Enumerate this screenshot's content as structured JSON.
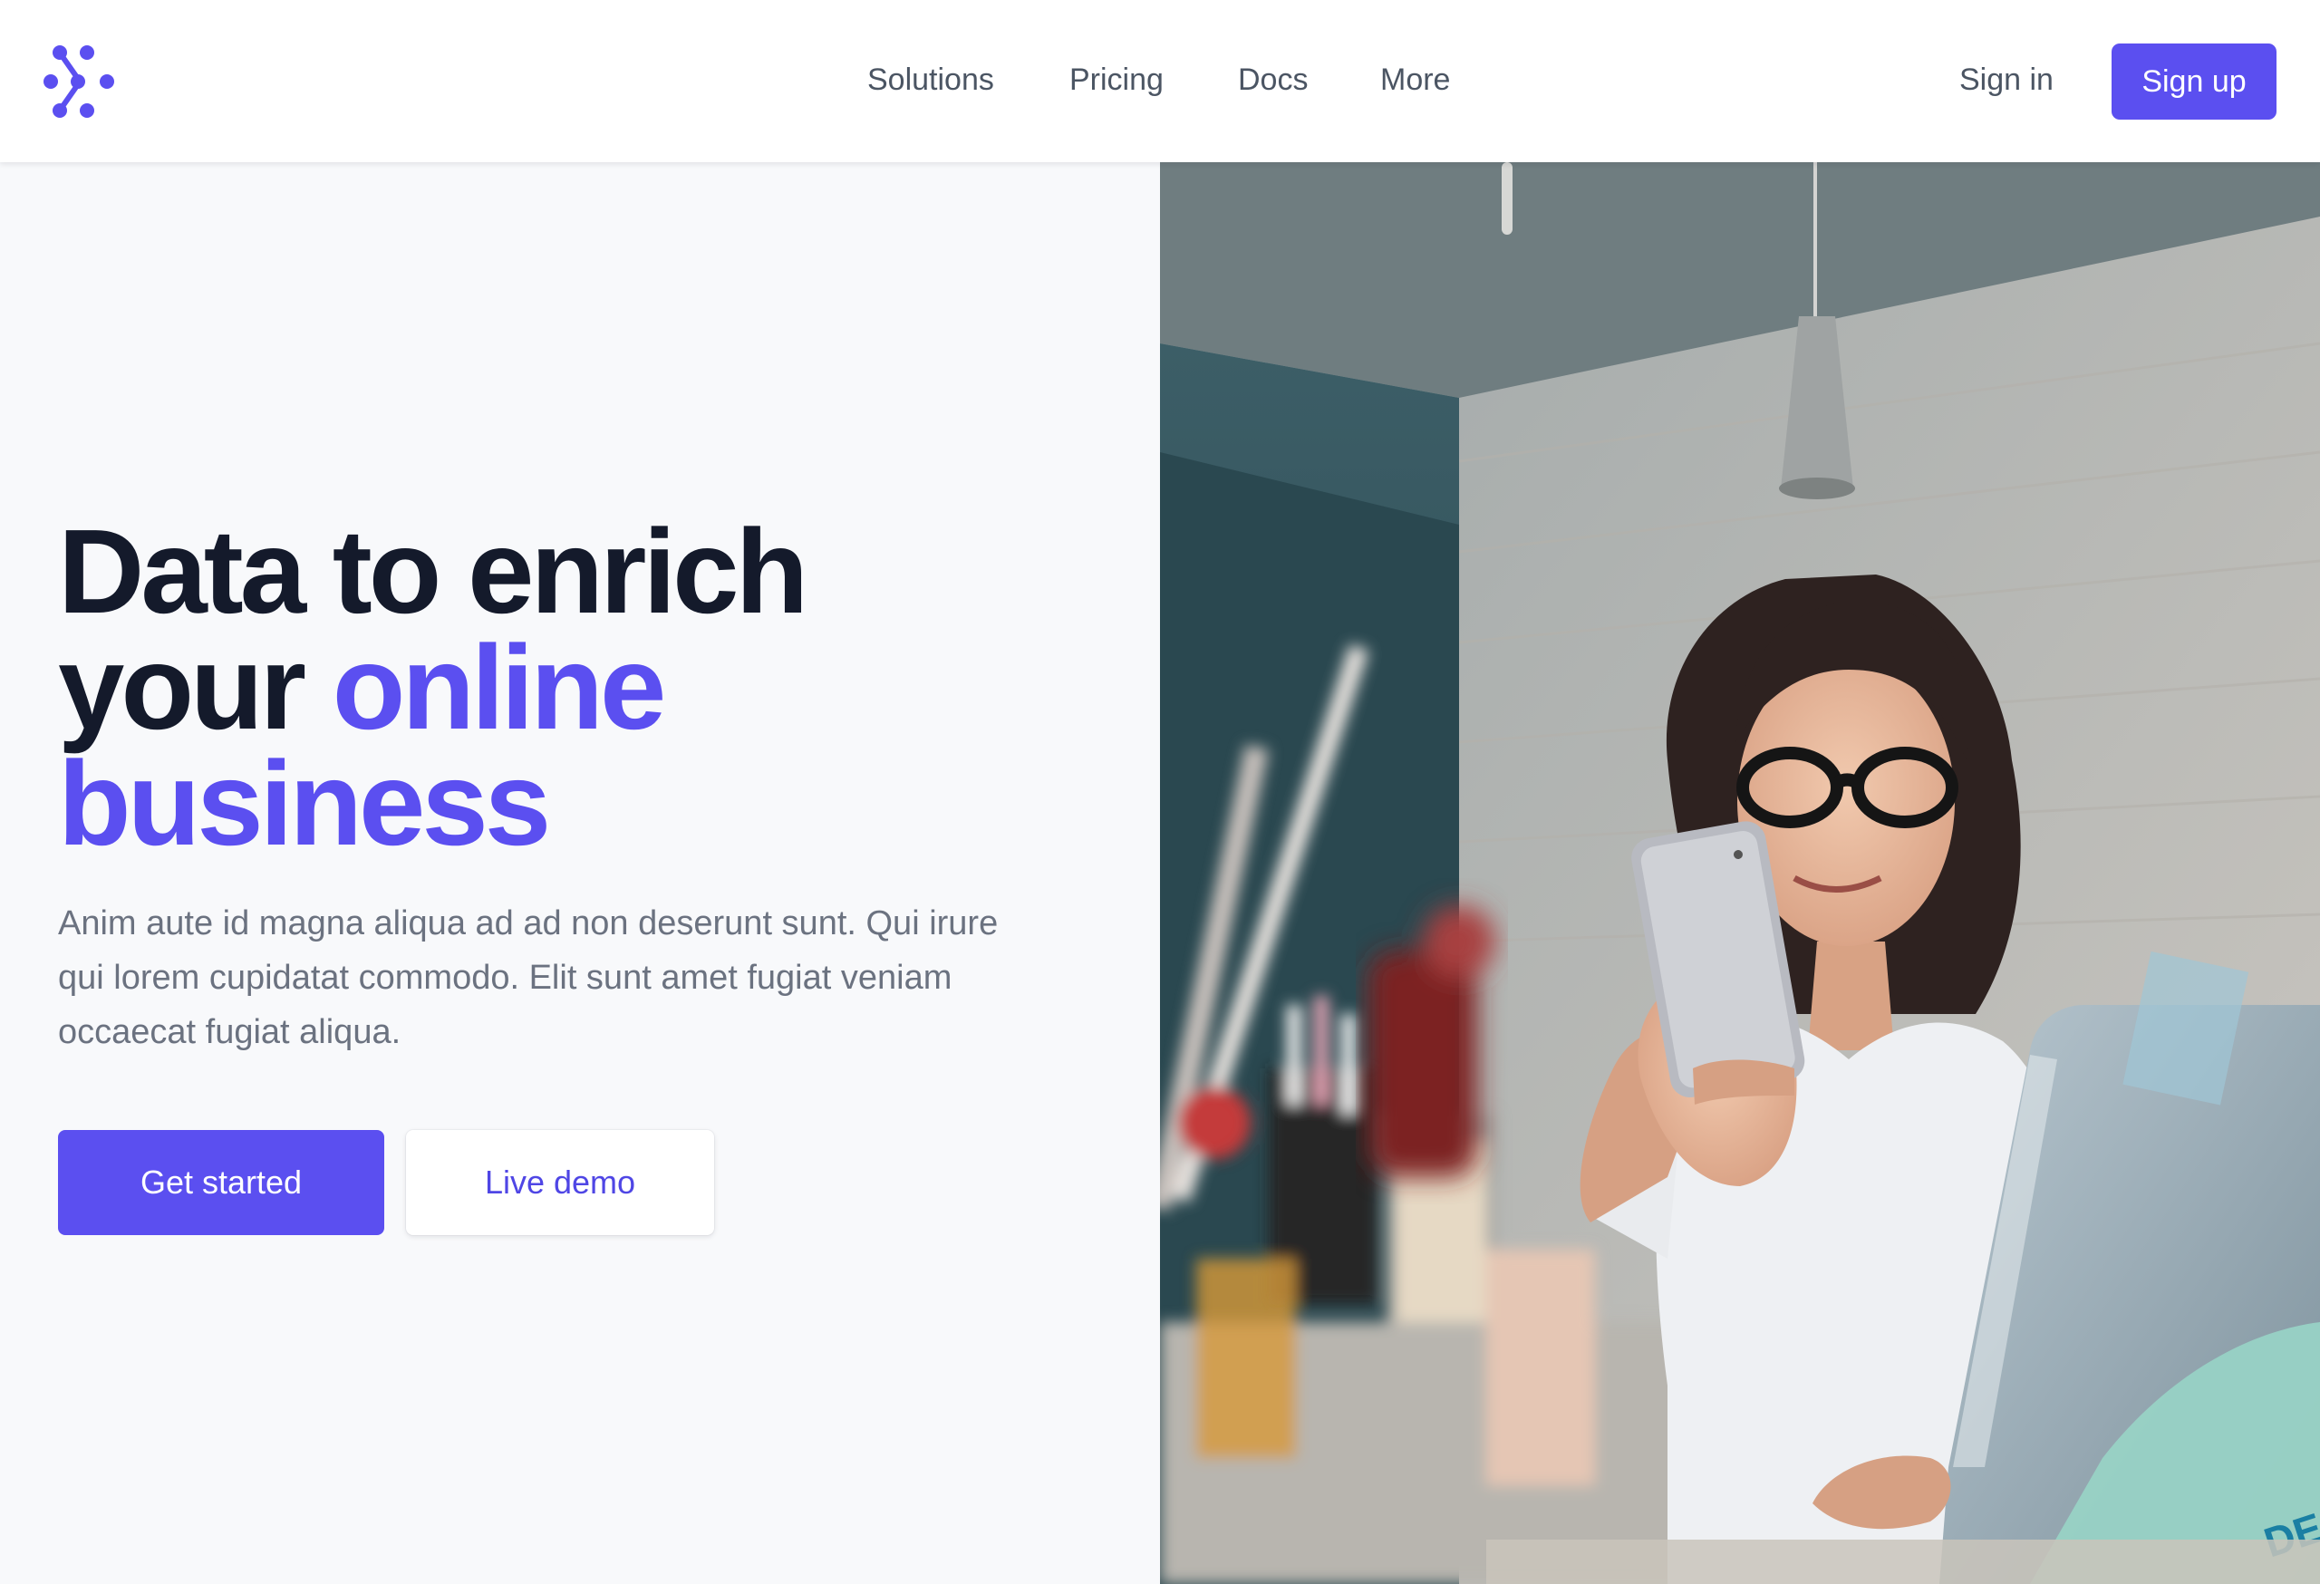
{
  "brand": {
    "logo_icon": "dots-logo-icon",
    "color": "#5b4ff0"
  },
  "nav": {
    "items": [
      {
        "label": "Solutions"
      },
      {
        "label": "Pricing"
      },
      {
        "label": "Docs"
      },
      {
        "label": "More"
      }
    ],
    "sign_in": "Sign in",
    "sign_up": "Sign up"
  },
  "hero": {
    "headline_part1": "Data to enrich",
    "headline_part2": "your ",
    "headline_accent": "online business",
    "description": "Anim aute id magna aliqua ad ad non deserunt sunt. Qui irure qui lorem cupidatat commodo. Elit sunt amet fugiat veniam occaecat fugiat aliqua.",
    "primary_button": "Get started",
    "secondary_button": "Live demo",
    "image_subject": "woman-with-phone-and-laptop-photo"
  },
  "colors": {
    "accent": "#5b4ff0",
    "heading": "#141a2b",
    "body_text": "#6b7280",
    "nav_text": "#4b5563",
    "background": "#f8f9fb"
  }
}
